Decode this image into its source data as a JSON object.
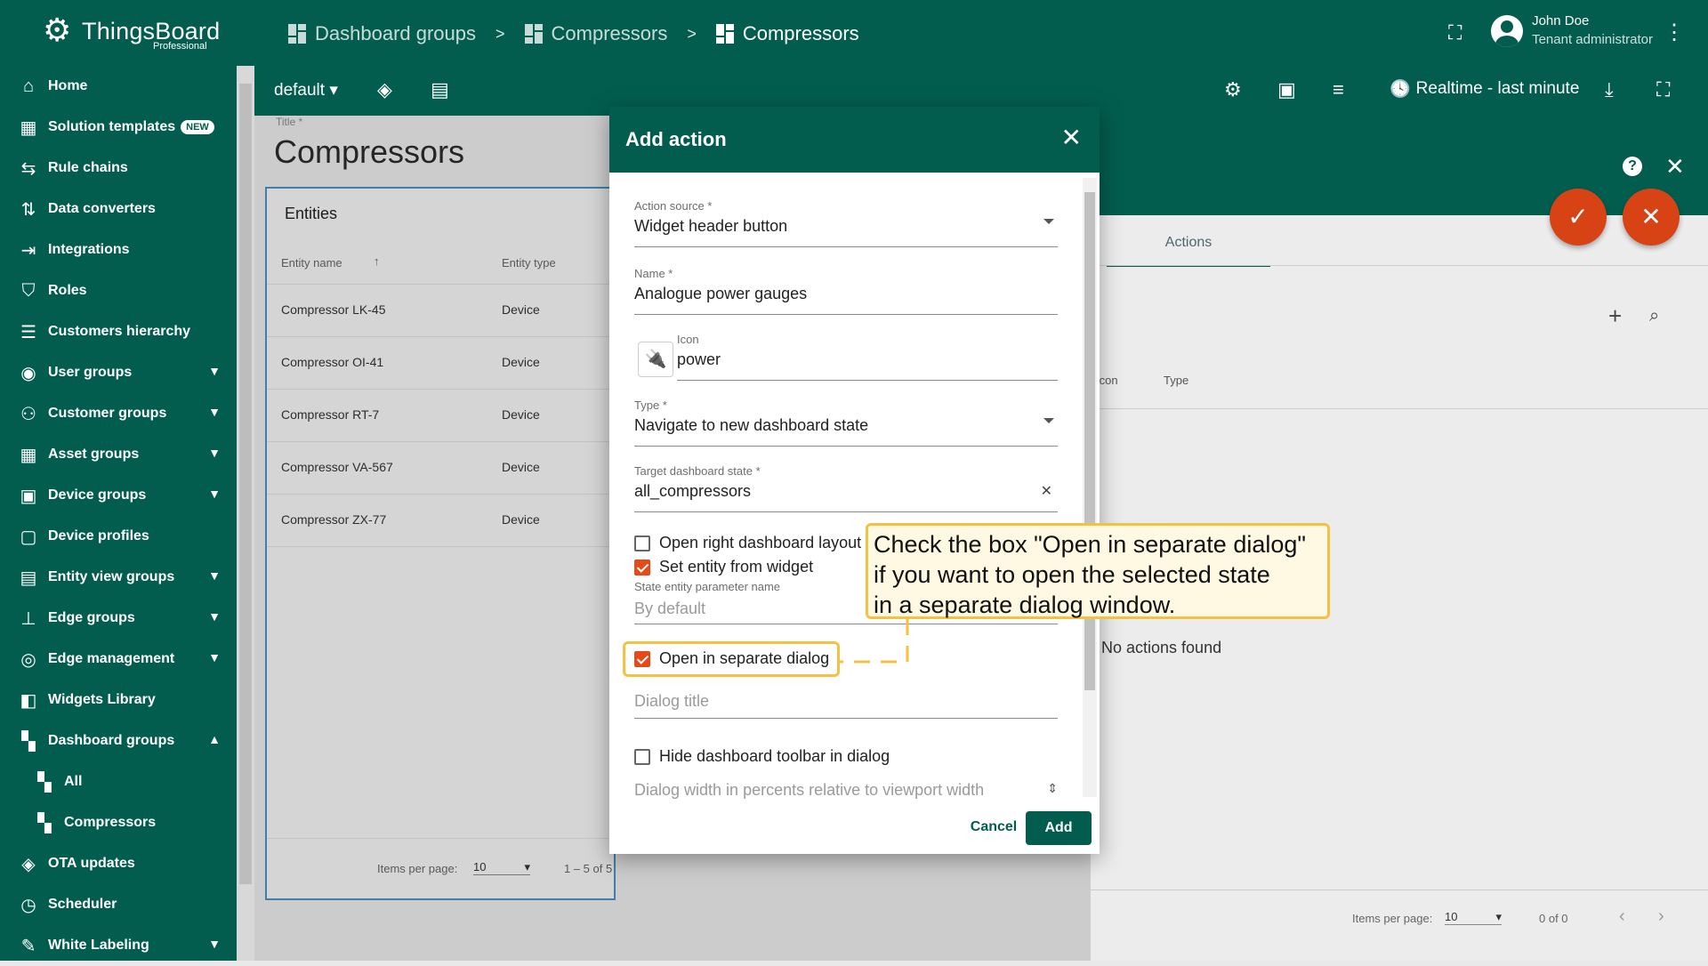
{
  "app": {
    "name": "ThingsBoard",
    "edition": "Professional"
  },
  "breadcrumb": [
    "Dashboard groups",
    "Compressors",
    "Compressors"
  ],
  "user": {
    "name": "John Doe",
    "role": "Tenant administrator"
  },
  "sidebar": {
    "items": [
      {
        "label": "Home",
        "icon": "home-icon"
      },
      {
        "label": "Solution templates",
        "badge": "NEW",
        "icon": "grid-icon"
      },
      {
        "label": "Rule chains",
        "icon": "rule-chains-icon"
      },
      {
        "label": "Data converters",
        "icon": "converter-icon"
      },
      {
        "label": "Integrations",
        "icon": "integration-icon"
      },
      {
        "label": "Roles",
        "icon": "shield-icon"
      },
      {
        "label": "Customers hierarchy",
        "icon": "hierarchy-icon"
      },
      {
        "label": "User groups",
        "icon": "user-icon",
        "expandable": true
      },
      {
        "label": "Customer groups",
        "icon": "customers-icon",
        "expandable": true
      },
      {
        "label": "Asset groups",
        "icon": "asset-icon",
        "expandable": true
      },
      {
        "label": "Device groups",
        "icon": "device-icon",
        "expandable": true
      },
      {
        "label": "Device profiles",
        "icon": "device-profile-icon"
      },
      {
        "label": "Entity view groups",
        "icon": "entity-view-icon",
        "expandable": true
      },
      {
        "label": "Edge groups",
        "icon": "edge-icon",
        "expandable": true
      },
      {
        "label": "Edge management",
        "icon": "edge-management-icon",
        "expandable": true
      },
      {
        "label": "Widgets Library",
        "icon": "widgets-icon"
      },
      {
        "label": "Dashboard groups",
        "icon": "dashboard-icon",
        "expanded": true
      },
      {
        "label": "All",
        "icon": "dashboard-icon",
        "sub": true
      },
      {
        "label": "Compressors",
        "icon": "dashboard-icon",
        "sub": true
      },
      {
        "label": "OTA updates",
        "icon": "ota-icon"
      },
      {
        "label": "Scheduler",
        "icon": "clock-icon"
      },
      {
        "label": "White Labeling",
        "icon": "paint-icon",
        "expandable": true
      }
    ]
  },
  "toolbar": {
    "state": "default",
    "realtime": "Realtime - last minute"
  },
  "dashboard": {
    "title_label": "Title *",
    "title": "Compressors"
  },
  "entities_widget": {
    "title": "Entities",
    "columns": [
      "Entity name",
      "Entity type"
    ],
    "rows": [
      {
        "name": "Compressor LK-45",
        "type": "Device"
      },
      {
        "name": "Compressor OI-41",
        "type": "Device"
      },
      {
        "name": "Compressor RT-7",
        "type": "Device"
      },
      {
        "name": "Compressor VA-567",
        "type": "Device"
      },
      {
        "name": "Compressor ZX-77",
        "type": "Device"
      }
    ],
    "items_per_page_label": "Items per page:",
    "items_per_page": "10",
    "range": "1 – 5 of 5"
  },
  "actions_panel": {
    "tab": "Actions",
    "columns": [
      "Icon",
      "Type"
    ],
    "empty": "No actions found",
    "items_per_page_label": "Items per page:",
    "items_per_page": "10",
    "range": "0 of 0"
  },
  "modal": {
    "title": "Add action",
    "action_source": {
      "label": "Action source *",
      "value": "Widget header button"
    },
    "name": {
      "label": "Name *",
      "value": "Analogue power gauges"
    },
    "icon": {
      "label": "Icon",
      "value": "power"
    },
    "type": {
      "label": "Type *",
      "value": "Navigate to new dashboard state"
    },
    "target_state": {
      "label": "Target dashboard state *",
      "value": "all_compressors"
    },
    "open_right_layout": {
      "label": "Open right dashboard layout",
      "checked": false
    },
    "set_entity": {
      "label": "Set entity from widget",
      "checked": true
    },
    "state_entity_param": {
      "label": "State entity parameter name",
      "placeholder": "By default"
    },
    "open_separate_dialog": {
      "label": "Open in separate dialog",
      "checked": true
    },
    "dialog_title": {
      "placeholder": "Dialog title"
    },
    "hide_toolbar": {
      "label": "Hide dashboard toolbar in dialog",
      "checked": false
    },
    "dialog_width": {
      "placeholder": "Dialog width in percents relative to viewport width"
    },
    "cancel": "Cancel",
    "add": "Add"
  },
  "callout": {
    "line1": "Check the box \"Open in separate dialog\"",
    "line2": "if you want to open the selected state",
    "line3": "in a separate dialog window."
  }
}
